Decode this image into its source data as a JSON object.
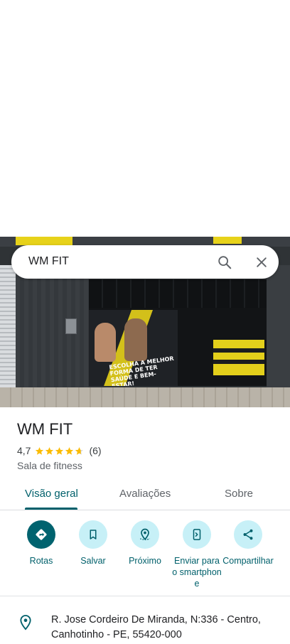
{
  "search": {
    "query": "WM FIT"
  },
  "photo": {
    "slogan": "ESCOLHA A MELHOR FORMA DE TER SAÚDE E BEM-ESTAR!"
  },
  "place": {
    "name": "WM FIT",
    "rating": "4,7",
    "rating_value": 4.7,
    "review_count": "(6)",
    "category": "Sala de fitness"
  },
  "tabs": [
    {
      "label": "Visão geral",
      "active": true
    },
    {
      "label": "Avaliações",
      "active": false
    },
    {
      "label": "Sobre",
      "active": false
    }
  ],
  "actions": [
    {
      "label": "Rotas",
      "icon": "directions-icon"
    },
    {
      "label": "Salvar",
      "icon": "bookmark-icon"
    },
    {
      "label": "Próximo",
      "icon": "nearby-icon"
    },
    {
      "label": "Enviar para o smartphone",
      "icon": "send-to-phone-icon"
    },
    {
      "label": "Compartilhar",
      "icon": "share-icon"
    }
  ],
  "address": {
    "text": "R. Jose Cordeiro De Miranda, N:336 - Centro, Canhotinho - PE, 55420-000"
  },
  "colors": {
    "accent": "#00606b",
    "accent_light": "#c7f0f7",
    "star": "#fbbc04"
  }
}
